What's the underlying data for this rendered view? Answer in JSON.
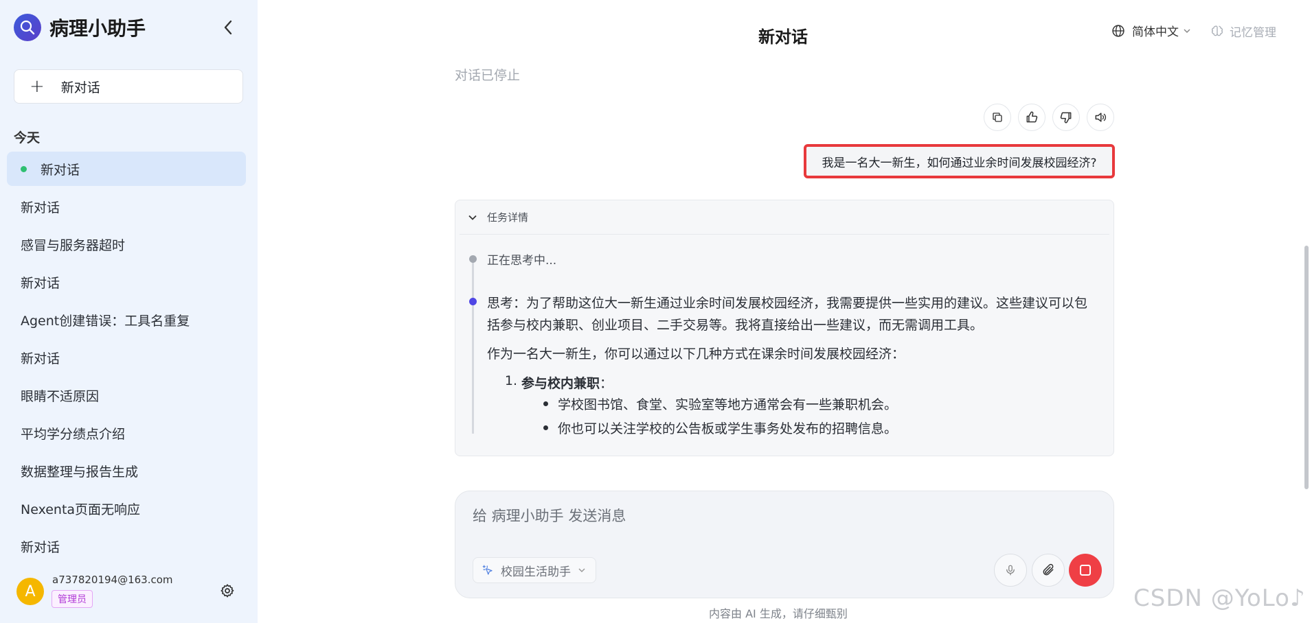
{
  "sidebar": {
    "brand_title": "病理小助手",
    "new_chat_label": "新对话",
    "section_today": "今天",
    "history": [
      {
        "label": "新对话",
        "active": true
      },
      {
        "label": "新对话"
      },
      {
        "label": "感冒与服务器超时"
      },
      {
        "label": "新对话"
      },
      {
        "label": "Agent创建错误：工具名重复"
      },
      {
        "label": "新对话"
      },
      {
        "label": "眼睛不适原因"
      },
      {
        "label": "平均学分绩点介绍"
      },
      {
        "label": "数据整理与报告生成"
      },
      {
        "label": "Nexenta页面无响应"
      },
      {
        "label": "新对话"
      }
    ],
    "user": {
      "avatar_letter": "A",
      "email": "a737820194@163.com",
      "role": "管理员"
    }
  },
  "header": {
    "title": "新对话",
    "language": "简体中文",
    "memory_label": "记忆管理"
  },
  "chat": {
    "stopped_note": "对话已停止",
    "user_message": "我是一名大一新生，如何通过业余时间发展校园经济?",
    "task": {
      "header_label": "任务详情",
      "thinking": "正在思考中...",
      "thought": "思考：为了帮助这位大一新生通过业余时间发展校园经济，我需要提供一些实用的建议。这些建议可以包括参与校内兼职、创业项目、二手交易等。我将直接给出一些建议，而无需调用工具。",
      "answer_intro": "作为一名大一新生，你可以通过以下几种方式在课余时间发展校园经济：",
      "list": [
        {
          "number": "1.",
          "title": "参与校内兼职",
          "suffix": "：",
          "bullets": [
            "学校图书馆、食堂、实验室等地方通常会有一些兼职机会。",
            "你也可以关注学校的公告板或学生事务处发布的招聘信息。"
          ]
        }
      ]
    }
  },
  "composer": {
    "placeholder": "给 病理小助手 发送消息",
    "agent_label": "校园生活助手"
  },
  "footer": {
    "disclaimer": "内容由 AI 生成，请仔细甄别",
    "watermark": "CSDN @YoLo♪"
  },
  "colors": {
    "accent": "#4f46e5",
    "stop": "#ef3f45",
    "highlight_border": "#e8393c",
    "sidebar_bg": "#eef4fd"
  }
}
